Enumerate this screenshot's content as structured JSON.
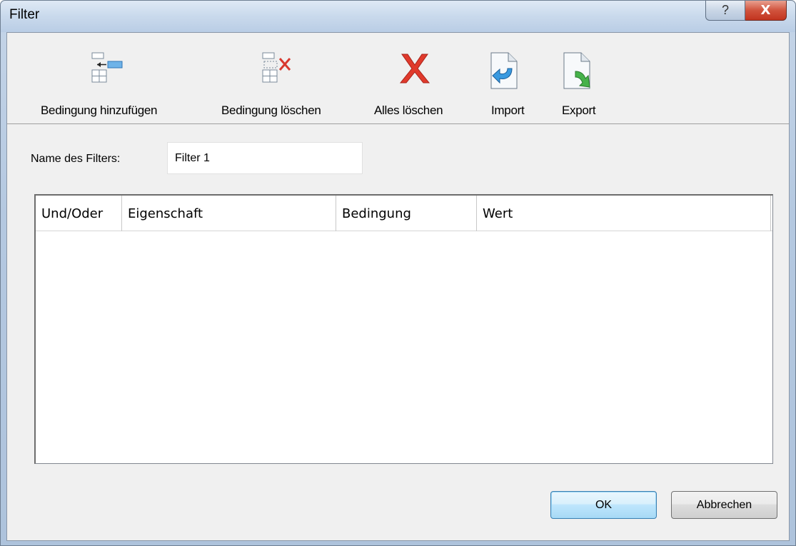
{
  "window": {
    "title": "Filter",
    "help_glyph": "?",
    "close_glyph": "X"
  },
  "toolbar": {
    "items": [
      {
        "label": "Bedingung hinzufügen",
        "icon": "add-condition-icon"
      },
      {
        "label": "Bedingung löschen",
        "icon": "delete-condition-icon"
      },
      {
        "label": "Alles löschen",
        "icon": "red-x-icon"
      },
      {
        "label": "Import",
        "icon": "import-document-icon"
      },
      {
        "label": "Export",
        "icon": "export-document-icon"
      }
    ]
  },
  "form": {
    "name_label": "Name des Filters:",
    "name_value": "Filter 1"
  },
  "grid": {
    "columns": [
      "Und/Oder",
      "Eigenschaft",
      "Bedingung",
      "Wert"
    ],
    "rows": []
  },
  "buttons": {
    "ok": "OK",
    "cancel": "Abbrechen"
  },
  "colors": {
    "close_red": "#c2341f",
    "ok_blue": "#3c7fb1",
    "dialog_bg": "#f0f0f0"
  }
}
